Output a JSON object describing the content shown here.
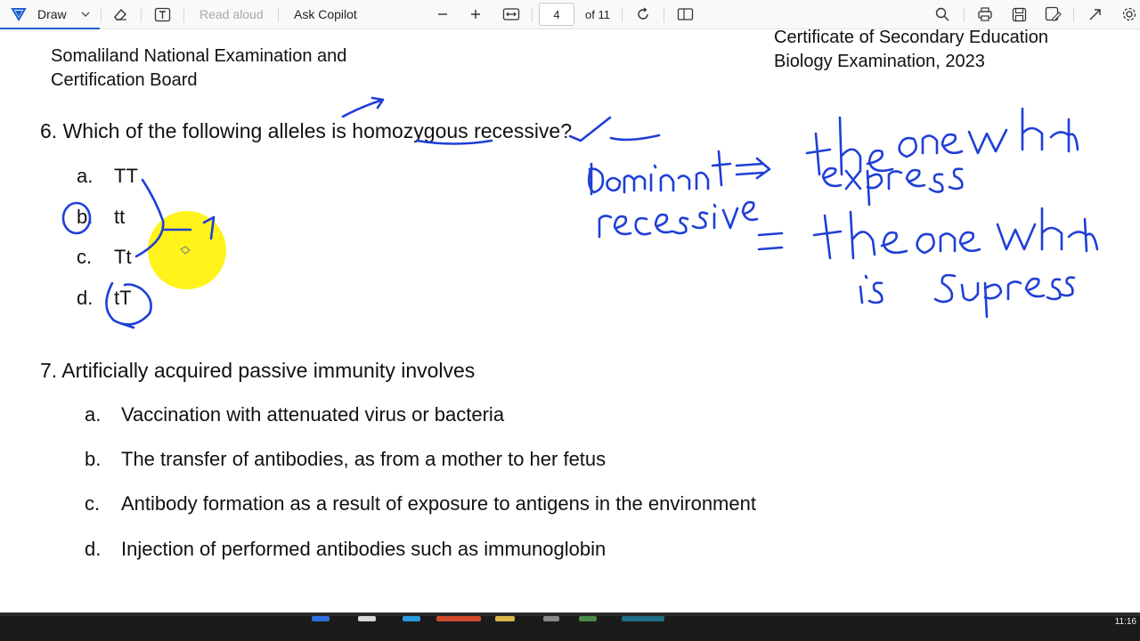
{
  "toolbar": {
    "draw_label": "Draw",
    "read_aloud_label": "Read aloud",
    "ask_copilot_label": "Ask Copilot",
    "current_page": "4",
    "page_total": "of 11"
  },
  "header": {
    "left_line1": "Somaliland National Examination and",
    "left_line2": "Certification Board",
    "right_line1": "Certificate of Secondary Education",
    "right_line2": "Biology Examination, 2023"
  },
  "q6": {
    "question": "6. Which of the following alleles is homozygous recessive?",
    "options": [
      {
        "letter": "a.",
        "text": "TT"
      },
      {
        "letter": "b.",
        "text": "tt"
      },
      {
        "letter": "c.",
        "text": "Tt"
      },
      {
        "letter": "d.",
        "text": "tT"
      }
    ]
  },
  "q7": {
    "question": "7. Artificially acquired passive immunity involves",
    "options": [
      {
        "letter": "a.",
        "text": "Vaccination with attenuated virus or bacteria"
      },
      {
        "letter": "b.",
        "text": "The transfer of antibodies, as from a mother to her fetus"
      },
      {
        "letter": "c.",
        "text": "Antibody formation as a result of exposure to antigens in the environment"
      },
      {
        "letter": "d.",
        "text": "Injection of performed antibodies such as immunoglobin"
      }
    ]
  },
  "taskbar": {
    "clock": "11:16"
  },
  "colors": {
    "ink": "#1f3fd6",
    "highlight": "#fff200",
    "toolbar_bg": "#f9f9f9",
    "accent": "#1a5fd0"
  },
  "icons": [
    "draw-icon",
    "chevron-down-icon",
    "eraser-icon",
    "text-icon",
    "zoom-out-icon",
    "zoom-in-icon",
    "fit-width-icon",
    "rotate-icon",
    "page-view-icon",
    "search-icon",
    "print-icon",
    "save-icon",
    "save-as-icon",
    "expand-icon",
    "settings-icon"
  ]
}
